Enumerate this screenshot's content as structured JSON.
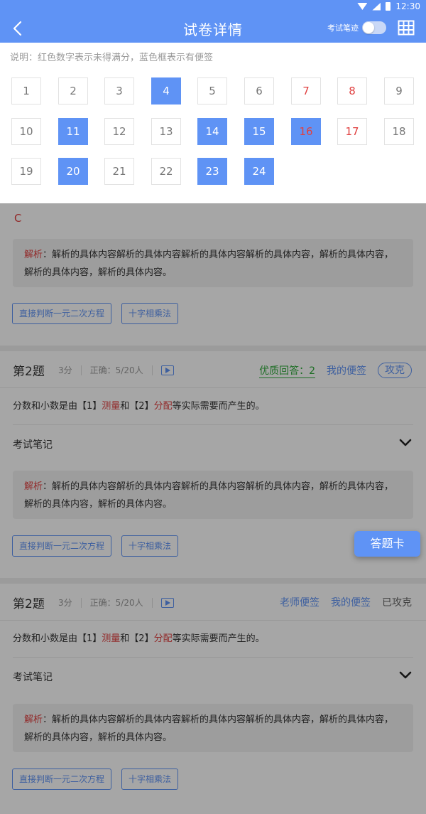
{
  "status_bar": {
    "time": "12:30"
  },
  "header": {
    "title": "试卷详情",
    "toggle_label": "考试笔迹",
    "toggle_on": false,
    "accent_color": "#5f93f5"
  },
  "panel": {
    "note": "说明：红色数字表示未得满分，蓝色框表示有便签",
    "numbers": [
      {
        "n": "1",
        "red": false,
        "blue": false
      },
      {
        "n": "2",
        "red": false,
        "blue": false
      },
      {
        "n": "3",
        "red": false,
        "blue": false
      },
      {
        "n": "4",
        "red": false,
        "blue": true
      },
      {
        "n": "5",
        "red": false,
        "blue": false
      },
      {
        "n": "6",
        "red": false,
        "blue": false
      },
      {
        "n": "7",
        "red": true,
        "blue": false
      },
      {
        "n": "8",
        "red": true,
        "blue": false
      },
      {
        "n": "9",
        "red": false,
        "blue": false
      },
      {
        "n": "10",
        "red": false,
        "blue": false
      },
      {
        "n": "11",
        "red": false,
        "blue": true
      },
      {
        "n": "12",
        "red": false,
        "blue": false
      },
      {
        "n": "13",
        "red": false,
        "blue": false
      },
      {
        "n": "14",
        "red": false,
        "blue": true
      },
      {
        "n": "15",
        "red": false,
        "blue": true
      },
      {
        "n": "16",
        "red": true,
        "blue": true
      },
      {
        "n": "17",
        "red": true,
        "blue": false
      },
      {
        "n": "18",
        "red": false,
        "blue": false
      },
      {
        "n": "19",
        "red": false,
        "blue": false
      },
      {
        "n": "20",
        "red": false,
        "blue": true
      },
      {
        "n": "21",
        "red": false,
        "blue": false
      },
      {
        "n": "22",
        "red": false,
        "blue": false
      },
      {
        "n": "23",
        "red": false,
        "blue": true
      },
      {
        "n": "24",
        "red": false,
        "blue": true
      }
    ]
  },
  "top_section": {
    "answer": "C",
    "analysis_label": "解析",
    "analysis_text": "：解析的具体内容解析的具体内容解析的具体内容解析的具体内容，解析的具体内容，解析的具体内容，解析的具体内容。",
    "tags": [
      "直接判断一元二次方程",
      "十字相乘法"
    ]
  },
  "questions": [
    {
      "title": "第2题",
      "score": "3分",
      "correct": "正确：5/20人",
      "quality_answer": "优质回答：2",
      "my_note": "我的便签",
      "attack": "攻克",
      "body_pre": "分数和小数是由【1】",
      "body_hl1": "测量",
      "body_mid": "和【2】",
      "body_hl2": "分配",
      "body_post": "等实际需要而产生的。",
      "notes_label": "考试笔记",
      "analysis_label": "解析",
      "analysis_text": "：解析的具体内容解析的具体内容解析的具体内容解析的具体内容，解析的具体内容，解析的具体内容，解析的具体内容。",
      "tags": [
        "直接判断一元二次方程",
        "十字相乘法"
      ]
    },
    {
      "title": "第2题",
      "score": "3分",
      "correct": "正确：5/20人",
      "teacher_note": "老师便签",
      "my_note": "我的便签",
      "attacked": "已攻克",
      "body_pre": "分数和小数是由【1】",
      "body_hl1": "测量",
      "body_mid": "和【2】",
      "body_hl2": "分配",
      "body_post": "等实际需要而产生的。",
      "notes_label": "考试笔记",
      "analysis_label": "解析",
      "analysis_text": "：解析的具体内容解析的具体内容解析的具体内容解析的具体内容，解析的具体内容，解析的具体内容，解析的具体内容。",
      "tags": [
        "直接判断一元二次方程",
        "十字相乘法"
      ]
    }
  ],
  "fab_label": "答题卡"
}
